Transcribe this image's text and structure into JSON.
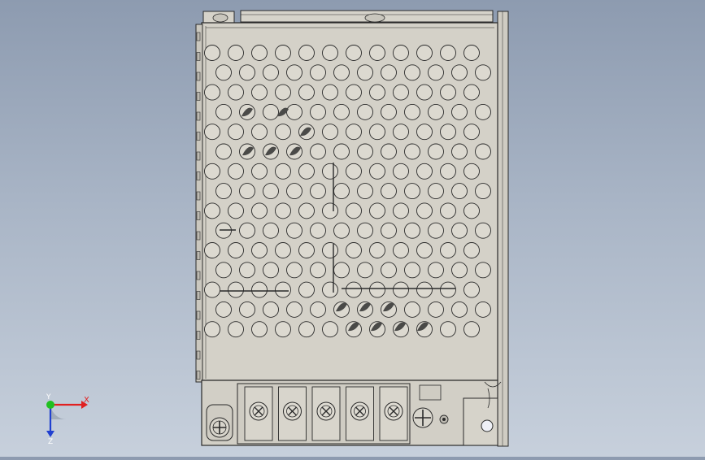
{
  "viewport": {
    "background_top": "#8d9bb0",
    "background_bottom": "#c7d0dc",
    "model": "power-supply-enclosure",
    "body_color": "#d2cfc6",
    "edge_color": "#2a2a2a"
  },
  "triad": {
    "x_label": "X",
    "y_label": "Y",
    "z_label": "Z",
    "x_color": "#e02020",
    "y_color": "#20c020",
    "z_color": "#2040d0"
  },
  "terminal_block": {
    "screw_count": 5,
    "has_ground_screw": true
  }
}
